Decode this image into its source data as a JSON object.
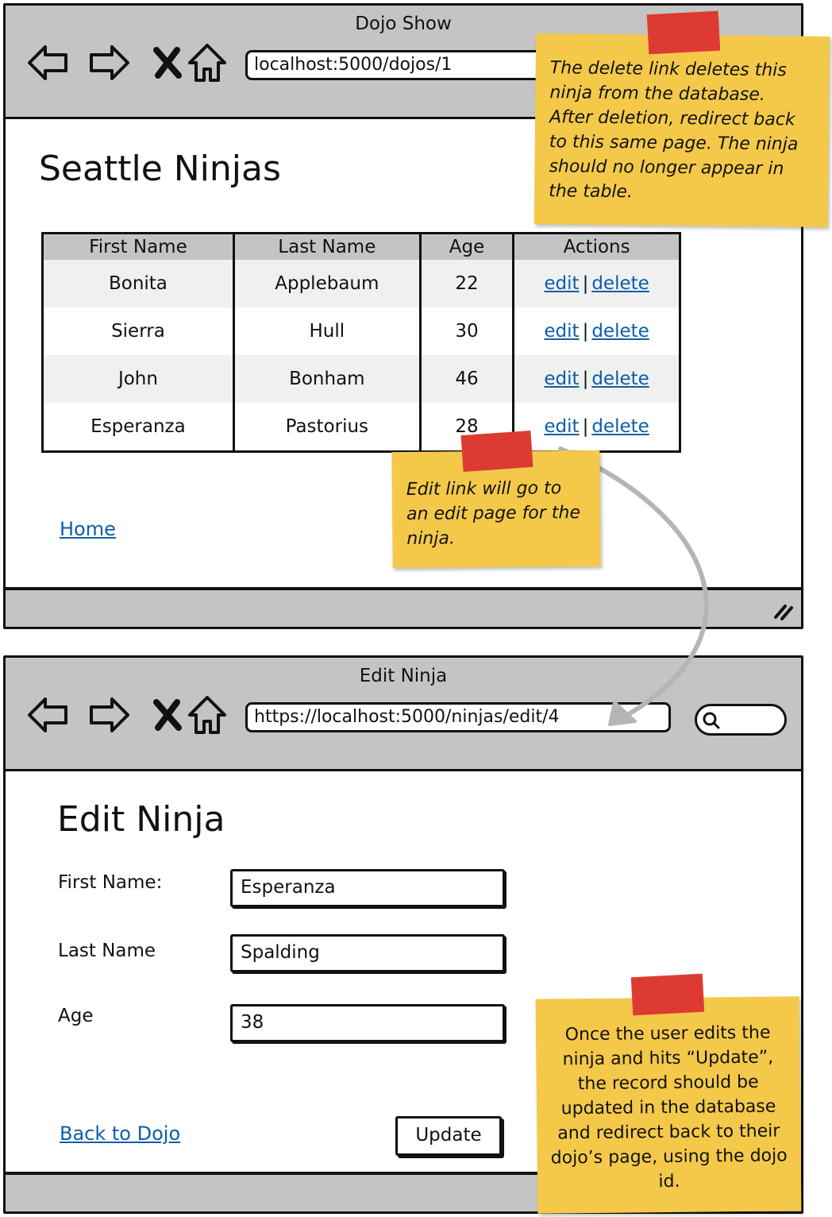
{
  "window1": {
    "title": "Dojo Show",
    "url": "localhost:5000/dojos/1",
    "heading": "Seattle Ninjas",
    "table": {
      "headers": [
        "First Name",
        "Last Name",
        "Age",
        "Actions"
      ],
      "rows": [
        {
          "first": "Bonita",
          "last": "Applebaum",
          "age": "22"
        },
        {
          "first": "Sierra",
          "last": "Hull",
          "age": "30"
        },
        {
          "first": "John",
          "last": "Bonham",
          "age": "46"
        },
        {
          "first": "Esperanza",
          "last": "Pastorius",
          "age": "28"
        }
      ],
      "edit_label": "edit",
      "separator": "|",
      "delete_label": "delete"
    },
    "home_link": "Home"
  },
  "window2": {
    "title": "Edit Ninja",
    "url": "https://localhost:5000/ninjas/edit/4",
    "heading": "Edit Ninja",
    "form": {
      "first_label": "First Name:",
      "first_value": "Esperanza",
      "last_label": "Last Name",
      "last_value": "Spalding",
      "age_label": "Age",
      "age_value": "38"
    },
    "back_link": "Back to Dojo",
    "update_label": "Update"
  },
  "notes": {
    "delete_note": "The delete link deletes this ninja from the database. After deletion, redirect back to this same page. The ninja should no longer appear in the table.",
    "edit_note": "Edit link will go to an edit page for the ninja.",
    "update_note": "Once the user edits the ninja and hits “Update”, the record should be updated in the database and redirect back to their dojo’s page, using the dojo id."
  },
  "colors": {
    "chrome_gray": "#c4c4c4",
    "link_blue": "#0d5ea7",
    "sticky_yellow": "#f4c94a",
    "tape_red": "#dd3b32"
  },
  "icons": [
    "back-arrow-icon",
    "forward-arrow-icon",
    "stop-x-icon",
    "home-icon",
    "search-icon",
    "resize-grip-icon"
  ]
}
